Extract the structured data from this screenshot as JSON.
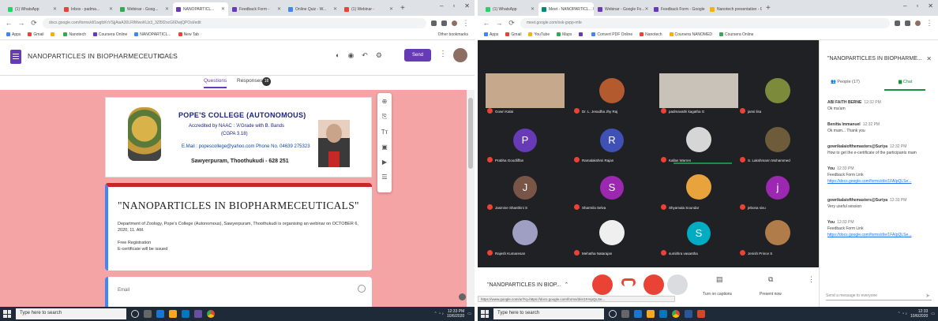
{
  "left": {
    "tabs": [
      {
        "label": "(1) WhatsApp",
        "color": "#25d366"
      },
      {
        "label": "Inbox - padma...",
        "color": "#ea4335"
      },
      {
        "label": "Webinar - Goog...",
        "color": "#34a853"
      },
      {
        "label": "NANOPARTICL...",
        "color": "#673ab7",
        "active": true
      },
      {
        "label": "Feedback Form -",
        "color": "#673ab7"
      },
      {
        "label": "Online Quiz - W...",
        "color": "#4285f4"
      },
      {
        "label": "(1) Webinar -",
        "color": "#ea4335"
      }
    ],
    "url": "docs.google.com/forms/d/1wgfzKrVSjjAiaA30LRlWwoKUz3_3Zl5f2ocG6DwjQPOsI/edit",
    "bookmarks": [
      "Apps",
      "Gmail",
      "",
      "Nanotech",
      "Coursera Online",
      "NANOPARTICL...",
      "New Tab"
    ],
    "other_bookmarks": "Other bookmarks",
    "doc_title": "NANOPARTICLES IN BIOPHARMECEUTICALS",
    "send_label": "Send",
    "tab_questions": "Questions",
    "tab_responses": "Responses",
    "responses_count": "18",
    "banner": {
      "college": "POPE'S COLLEGE (AUTONOMOUS)",
      "accreditation": "Accredited by NAAC : 'A'Grade with B. Bands",
      "cpe": "(CGPA 3.18)",
      "contact": "E.Mail : popescollege@yahoo.com     Phone No. 04639 275323",
      "address": "Sawyerpuram, Thoothukudi - 628 251"
    },
    "form_title": "\"NANOPARTICLES IN  BIOPHARMECEUTICALS\"",
    "form_desc": "Department of Zoology, Pope's College (Autonomous), Sawyerpuram, Thoothukudi is organising an webinar on OCTOBER 6, 2020, 11. AM.",
    "free_reg": "Free Registration",
    "certificate_note": "E-certificate will be issued",
    "email_label": "Email",
    "search_placeholder": "Type here to search",
    "clock_time": "12:33 PM",
    "clock_date": "10/6/2020"
  },
  "right": {
    "tabs": [
      {
        "label": "(1) WhatsApp",
        "color": "#25d366"
      },
      {
        "label": "Meet - NANOPARTICL...",
        "color": "#00897b",
        "active": true
      },
      {
        "label": "Webinar - Google Fo...",
        "color": "#673ab7"
      },
      {
        "label": "Feedback Form - Google For...",
        "color": "#673ab7"
      },
      {
        "label": "Nanotech presentation - Goog...",
        "color": "#f4b400"
      }
    ],
    "url": "meet.google.com/xxk-gvpp-mfe",
    "bookmarks": [
      "Apps",
      "Gmail",
      "YouTube",
      "Maps",
      "",
      "Convert PDF Online",
      "Nanotech",
      "Coursera NANOMED",
      "Coursera Online"
    ],
    "participants": [
      {
        "name": "Gowri Kalai",
        "kind": "video",
        "color": "#c6a88c"
      },
      {
        "name": "Dr. L. Jesudha Jhy Raj",
        "kind": "photo",
        "color": "#b35b2e"
      },
      {
        "name": "padmavathi kagatha G",
        "kind": "video",
        "color": "#c9c2b8"
      },
      {
        "name": "jansi lisa",
        "kind": "photo",
        "color": "#7c8a3c"
      },
      {
        "name": "Prabha Goodliffan",
        "kind": "avatar",
        "letter": "P",
        "color": "#673ab7"
      },
      {
        "name": "Ramalakshmi Rajan",
        "kind": "avatar",
        "letter": "R",
        "color": "#3f51b5"
      },
      {
        "name": "Kallas Warren",
        "kind": "photo",
        "color": "#d6d6d6",
        "speaking": true
      },
      {
        "name": "S. Lakshmann Mohammed",
        "kind": "photo",
        "color": "#6d5b3a"
      },
      {
        "name": "Jasmine Shanthini S",
        "kind": "avatar",
        "letter": "J",
        "color": "#795548"
      },
      {
        "name": "Sharmila Selva",
        "kind": "avatar",
        "letter": "S",
        "color": "#9c27b0"
      },
      {
        "name": "Shyamala Soundar",
        "kind": "photo",
        "color": "#e8a33c"
      },
      {
        "name": "jebona sivu",
        "kind": "avatar",
        "letter": "j",
        "color": "#9c27b0"
      },
      {
        "name": "Rajesh Kumaresan",
        "kind": "photo",
        "color": "#9e9fc2"
      },
      {
        "name": "Mehatha Natarajan",
        "kind": "photo",
        "color": "#efefef"
      },
      {
        "name": "sumithra vasantha",
        "kind": "avatar",
        "letter": "S",
        "color": "#00acc1"
      },
      {
        "name": "Jenish Prince S",
        "kind": "photo",
        "color": "#b07d4a"
      }
    ],
    "meeting_name": "\"NANOPARTICLES IN BIOP...",
    "turn_on_captions": "Turn on captions",
    "present_now": "Present now",
    "url_tip": "https://www.google.com/url?q=https://docs.google.com/forms/d/e/1FAIpQLSe...",
    "panel_title": "\"NANOPARTICLES IN BIOPHARME...",
    "people_tab": "People (17)",
    "chat_tab": "Chat",
    "messages": [
      {
        "sender": "ABI FAITH BERNE",
        "time": "12:32 PM",
        "text": "Ok ma'am"
      },
      {
        "sender": "Benitta Immanuel",
        "time": "12:32 PM",
        "text": "Ok mam... Thank you"
      },
      {
        "sender": "gowrikalaiofthemasters@Suriya",
        "time": "12:32 PM",
        "text": "How to get the e-certificate of the participants mam"
      },
      {
        "sender": "You",
        "time": "12:33 PM",
        "text": "Feedback Form Link",
        "link": "https://docs.google.com/forms/d/e/1FAIpQLSe..."
      },
      {
        "sender": "gowrikalaiofthemasters@Suriya",
        "time": "12:33 PM",
        "text": "Very useful session"
      },
      {
        "sender": "You",
        "time": "12:33 PM",
        "text": "Feedback Form Link",
        "link": "https://docs.google.com/forms/d/e/1FAIpQLSe..."
      }
    ],
    "chat_placeholder": "Send a message to everyone",
    "search_placeholder": "Type here to search",
    "clock_time": "12:33",
    "clock_date": "10/6/2020"
  }
}
